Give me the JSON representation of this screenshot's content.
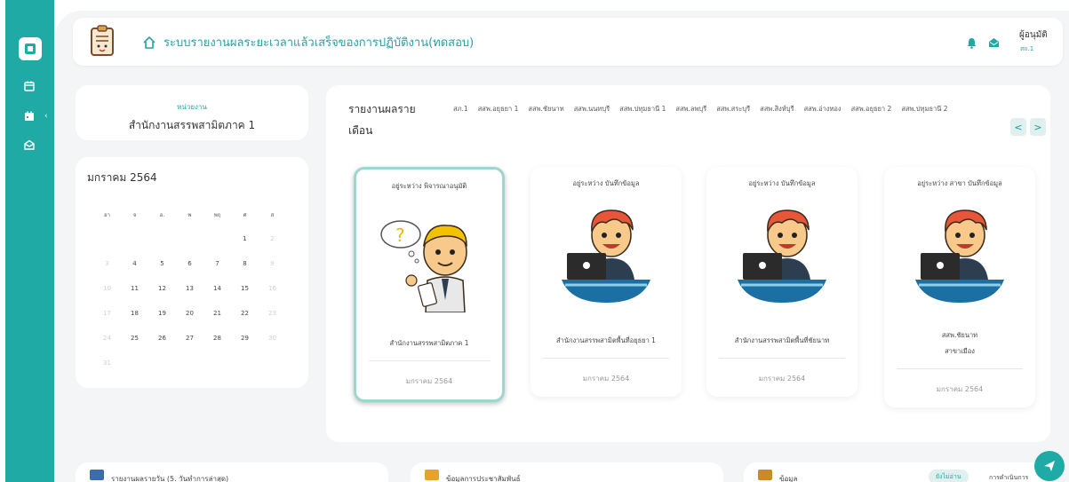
{
  "header": {
    "title": "ระบบรายงานผลระยะเวลาแล้วเสร็จของการปฏิบัติงาน(ทดสอบ)",
    "user_name": "ผู้อนุมัติ",
    "user_sub": "สถ.1"
  },
  "department": {
    "label": "หน่วยงาน",
    "name": "สำนักงานสรรพสามิตภาค 1"
  },
  "calendar": {
    "month": "มกราคม 2564",
    "weekdays": [
      "อา",
      "จ",
      "อ.",
      "พ",
      "พฤ",
      "ศ",
      "ส"
    ],
    "rows": [
      [
        "",
        "",
        "",
        "",
        "",
        "1",
        "2"
      ],
      [
        "3",
        "4",
        "5",
        "6",
        "7",
        "8",
        "9"
      ],
      [
        "10",
        "11",
        "12",
        "13",
        "14",
        "15",
        "16"
      ],
      [
        "17",
        "18",
        "19",
        "20",
        "21",
        "22",
        "23"
      ],
      [
        "24",
        "25",
        "26",
        "27",
        "28",
        "29",
        "30"
      ],
      [
        "31",
        "",
        "",
        "",
        "",
        "",
        ""
      ]
    ]
  },
  "report": {
    "title": "รายงานผลรายเดือน",
    "tabs": [
      "สภ.1",
      "สสพ.อยุธยา 1",
      "สสพ.ชัยนาท",
      "สสพ.นนทบุรี",
      "สสพ.ปทุมธานี 1",
      "สสพ.ลพบุรี",
      "สสพ.สระบุรี",
      "สสพ.สิงห์บุรี",
      "สสพ.อ่างทอง",
      "สสพ.อยุธยา 2",
      "สสพ.ปทุมธานี 2"
    ],
    "nav_prev": "<",
    "nav_next": ">",
    "cards": [
      {
        "status": "อยู่ระหว่าง พิจารณาอนุมัติ",
        "org": "สำนักงานสรรพสามิตภาค 1",
        "org2": "",
        "date": "มกราคม 2564"
      },
      {
        "status": "อยู่ระหว่าง บันทึกข้อมูล",
        "org": "สำนักงานสรรพสามิตพื้นที่อยุธยา 1",
        "org2": "",
        "date": "มกราคม 2564"
      },
      {
        "status": "อยู่ระหว่าง บันทึกข้อมูล",
        "org": "สำนักงานสรรพสามิตพื้นที่ชัยนาท",
        "org2": "",
        "date": "มกราคม 2564"
      },
      {
        "status": "อยู่ระหว่าง สาขา บันทึกข้อมูล",
        "org": "สสพ.ชัยนาท",
        "org2": "สาขาเมือง",
        "date": "มกราคม 2564"
      }
    ]
  },
  "bottom": {
    "card1": "รายงานผลรายวัน (5. วันทำการล่าสุด)",
    "card2": "ข้อมูลการประชาสัมพันธ์",
    "card3": "ข้อมูล",
    "chip": "ยังไม่อ่าน",
    "more": "การดำเนินการ"
  },
  "colors": {
    "accent": "#1faaa6",
    "active_border": "#9ed6cf"
  }
}
